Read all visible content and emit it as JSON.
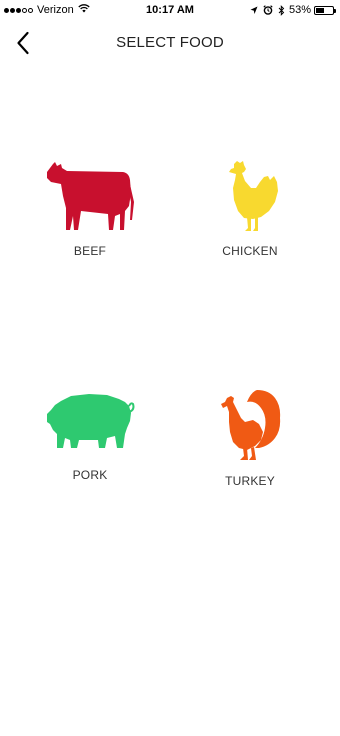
{
  "status_bar": {
    "carrier": "Verizon",
    "time": "10:17 AM",
    "battery": "53%",
    "battery_level": 0.53,
    "icons": [
      "signal-icon",
      "wifi-icon",
      "location-icon",
      "alarm-icon",
      "bluetooth-icon",
      "battery-icon"
    ]
  },
  "header": {
    "title": "SELECT FOOD",
    "back_icon": "chevron-left-icon"
  },
  "foods": [
    {
      "label": "BEEF",
      "icon": "cow-icon",
      "color": "#c8102e"
    },
    {
      "label": "CHICKEN",
      "icon": "chicken-icon",
      "color": "#f8d92f"
    },
    {
      "label": "PORK",
      "icon": "pig-icon",
      "color": "#2ec970"
    },
    {
      "label": "TURKEY",
      "icon": "turkey-icon",
      "color": "#f05a14"
    }
  ]
}
